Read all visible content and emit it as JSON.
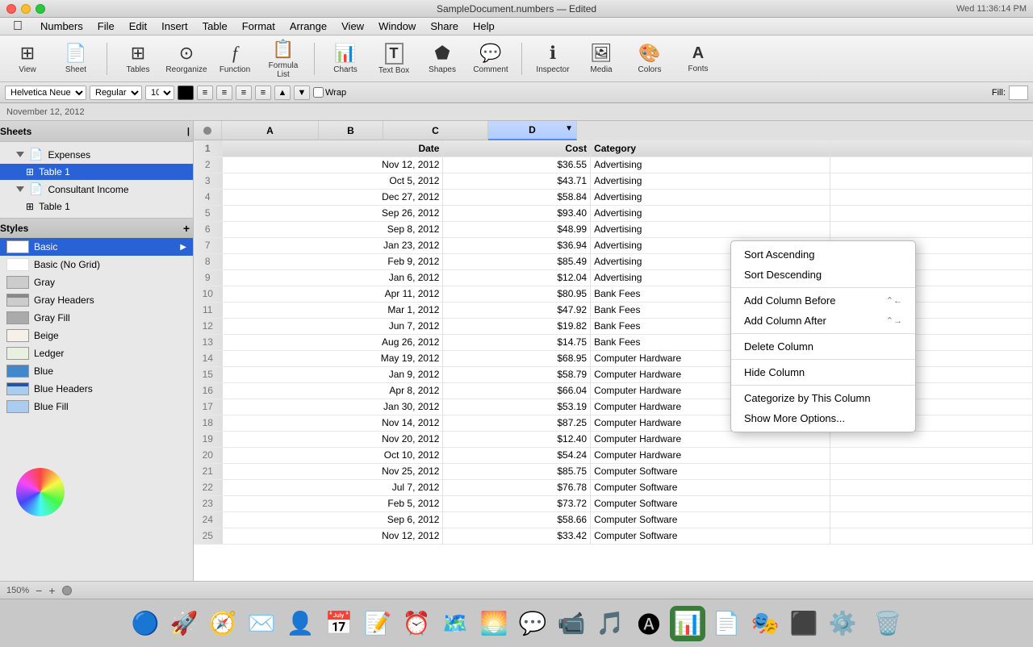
{
  "app": {
    "name": "Numbers",
    "document": "SampleDocument.numbers",
    "document_status": "Edited",
    "date": "November 12, 2012",
    "time": "Wed 11:36:14 PM"
  },
  "menubar": {
    "items": [
      "Apple",
      "Numbers",
      "File",
      "Edit",
      "Insert",
      "Table",
      "Format",
      "Arrange",
      "View",
      "Window",
      "Share",
      "Help"
    ]
  },
  "toolbar": {
    "buttons": [
      {
        "label": "View",
        "icon": "⊞"
      },
      {
        "label": "Sheet",
        "icon": "📄"
      },
      {
        "label": "Tables",
        "icon": "⊞"
      },
      {
        "label": "Reorganize",
        "icon": "⊙"
      },
      {
        "label": "Function",
        "icon": "ƒ"
      },
      {
        "label": "Formula List",
        "icon": "📋"
      },
      {
        "label": "Charts",
        "icon": "📊"
      },
      {
        "label": "Text Box",
        "icon": "T"
      },
      {
        "label": "Shapes",
        "icon": "⬟"
      },
      {
        "label": "Comment",
        "icon": "💬"
      },
      {
        "label": "Inspector",
        "icon": "ℹ"
      },
      {
        "label": "Media",
        "icon": "🖼"
      },
      {
        "label": "Colors",
        "icon": "🎨"
      },
      {
        "label": "Fonts",
        "icon": "A"
      },
      {
        "label": "Charts",
        "icon": "📉"
      }
    ]
  },
  "format_bar": {
    "font": "Helvetica Neue",
    "style": "Regular",
    "size": "10"
  },
  "sidebar": {
    "sheets_label": "Sheets",
    "items": [
      {
        "label": "Expenses",
        "level": 1,
        "type": "sheet",
        "expanded": true
      },
      {
        "label": "Table 1",
        "level": 2,
        "type": "table",
        "selected": true
      },
      {
        "label": "Consultant Income",
        "level": 1,
        "type": "sheet",
        "expanded": true
      },
      {
        "label": "Table 1",
        "level": 2,
        "type": "table"
      }
    ]
  },
  "styles": {
    "label": "Styles",
    "items": [
      {
        "name": "Basic",
        "selected": true,
        "swatch": "#ffffff"
      },
      {
        "name": "Basic (No Grid)",
        "selected": false,
        "swatch": "#ffffff"
      },
      {
        "name": "Gray",
        "selected": false,
        "swatch": "#cccccc"
      },
      {
        "name": "Gray Headers",
        "selected": false,
        "swatch": "#999999"
      },
      {
        "name": "Gray Fill",
        "selected": false,
        "swatch": "#aaaaaa"
      },
      {
        "name": "Beige",
        "selected": false,
        "swatch": "#f5f0e8"
      },
      {
        "name": "Ledger",
        "selected": false,
        "swatch": "#e8f0e8"
      },
      {
        "name": "Blue",
        "selected": false,
        "swatch": "#4488cc"
      },
      {
        "name": "Blue Headers",
        "selected": false,
        "swatch": "#2255aa"
      },
      {
        "name": "Blue Fill",
        "selected": false,
        "swatch": "#aaccee"
      }
    ]
  },
  "table": {
    "headers": [
      "Date",
      "Cost",
      "Category",
      "D"
    ],
    "col_letters": [
      "A",
      "B",
      "C",
      "D"
    ],
    "rows": [
      {
        "num": 1,
        "date": "Date",
        "cost": "Cost",
        "category": "Category",
        "header": true
      },
      {
        "num": 2,
        "date": "Nov 12, 2012",
        "cost": "$36.55",
        "category": "Advertising"
      },
      {
        "num": 3,
        "date": "Oct 5, 2012",
        "cost": "$43.71",
        "category": "Advertising"
      },
      {
        "num": 4,
        "date": "Dec 27, 2012",
        "cost": "$58.84",
        "category": "Advertising"
      },
      {
        "num": 5,
        "date": "Sep 26, 2012",
        "cost": "$93.40",
        "category": "Advertising"
      },
      {
        "num": 6,
        "date": "Sep 8, 2012",
        "cost": "$48.99",
        "category": "Advertising"
      },
      {
        "num": 7,
        "date": "Jan 23, 2012",
        "cost": "$36.94",
        "category": "Advertising"
      },
      {
        "num": 8,
        "date": "Feb 9, 2012",
        "cost": "$85.49",
        "category": "Advertising"
      },
      {
        "num": 9,
        "date": "Jan 6, 2012",
        "cost": "$12.04",
        "category": "Advertising"
      },
      {
        "num": 10,
        "date": "Apr 11, 2012",
        "cost": "$80.95",
        "category": "Bank Fees"
      },
      {
        "num": 11,
        "date": "Mar 1, 2012",
        "cost": "$47.92",
        "category": "Bank Fees"
      },
      {
        "num": 12,
        "date": "Jun 7, 2012",
        "cost": "$19.82",
        "category": "Bank Fees"
      },
      {
        "num": 13,
        "date": "Aug 26, 2012",
        "cost": "$14.75",
        "category": "Bank Fees"
      },
      {
        "num": 14,
        "date": "May 19, 2012",
        "cost": "$68.95",
        "category": "Computer Hardware"
      },
      {
        "num": 15,
        "date": "Jan 9, 2012",
        "cost": "$58.79",
        "category": "Computer Hardware"
      },
      {
        "num": 16,
        "date": "Apr 8, 2012",
        "cost": "$66.04",
        "category": "Computer Hardware"
      },
      {
        "num": 17,
        "date": "Jan 30, 2012",
        "cost": "$53.19",
        "category": "Computer Hardware"
      },
      {
        "num": 18,
        "date": "Nov 14, 2012",
        "cost": "$87.25",
        "category": "Computer Hardware"
      },
      {
        "num": 19,
        "date": "Nov 20, 2012",
        "cost": "$12.40",
        "category": "Computer Hardware"
      },
      {
        "num": 20,
        "date": "Oct 10, 2012",
        "cost": "$54.24",
        "category": "Computer Hardware"
      },
      {
        "num": 21,
        "date": "Nov 25, 2012",
        "cost": "$85.75",
        "category": "Computer Software"
      },
      {
        "num": 22,
        "date": "Jul 7, 2012",
        "cost": "$76.78",
        "category": "Computer Software"
      },
      {
        "num": 23,
        "date": "Feb 5, 2012",
        "cost": "$73.72",
        "category": "Computer Software"
      },
      {
        "num": 24,
        "date": "Sep 6, 2012",
        "cost": "$58.66",
        "category": "Computer Software"
      },
      {
        "num": 25,
        "date": "Nov 12, 2012",
        "cost": "$33.42",
        "category": "Computer Software"
      }
    ]
  },
  "context_menu": {
    "items": [
      {
        "label": "Sort Ascending",
        "shortcut": "",
        "separator_after": false
      },
      {
        "label": "Sort Descending",
        "shortcut": "",
        "separator_after": true
      },
      {
        "label": "Add Column Before",
        "shortcut": "⌃←",
        "separator_after": false
      },
      {
        "label": "Add Column After",
        "shortcut": "⌃→",
        "separator_after": true
      },
      {
        "label": "Delete Column",
        "shortcut": "",
        "separator_after": false
      },
      {
        "label": "Hide Column",
        "shortcut": "",
        "separator_after": true
      },
      {
        "label": "Categorize by This Column",
        "shortcut": "",
        "separator_after": false
      },
      {
        "label": "Show More Options...",
        "shortcut": "",
        "separator_after": false
      }
    ]
  },
  "status_bar": {
    "zoom": "150%"
  }
}
